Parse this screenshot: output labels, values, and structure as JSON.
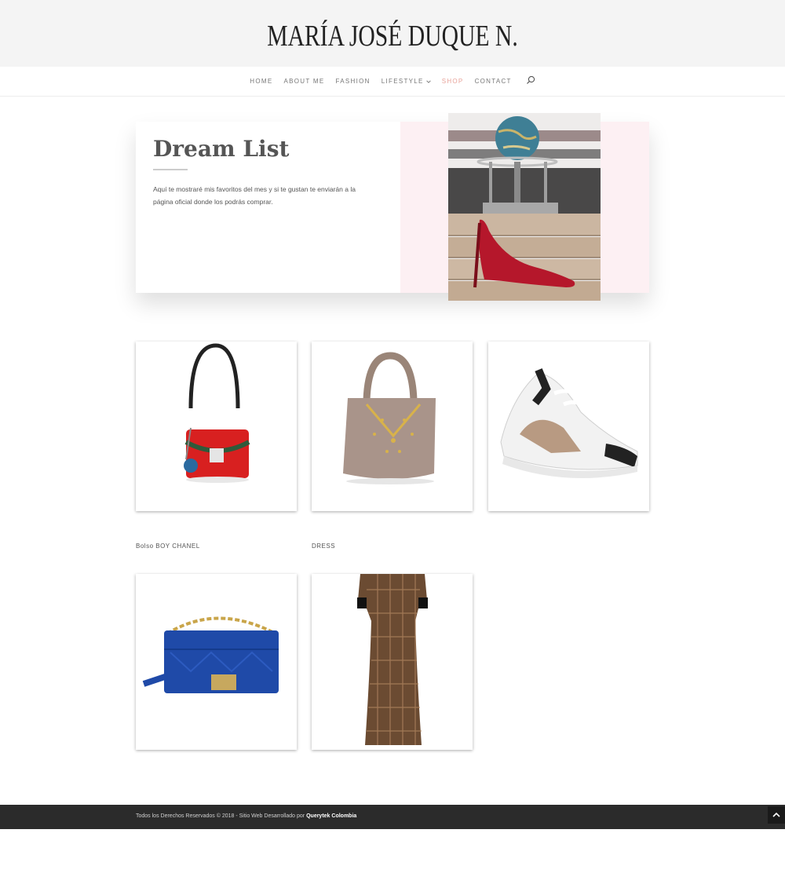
{
  "site": {
    "title": "MARÍA JOSÉ DUQUE N."
  },
  "nav": {
    "items": [
      {
        "label": "HOME"
      },
      {
        "label": "ABOUT ME"
      },
      {
        "label": "FASHION"
      },
      {
        "label": "LIFESTYLE"
      },
      {
        "label": "SHOP"
      },
      {
        "label": "CONTACT"
      }
    ],
    "active": "SHOP",
    "active_color": "#e8a39a"
  },
  "hero": {
    "title": "Dream List",
    "text": "Aquí te mostraré mis favoritos del mes y si te gustan te enviarán a la página oficial donde los podrás comprar.",
    "accent_color": "#fdf0f3"
  },
  "products": {
    "captions": [
      "Bolso BOY CHANEL",
      "DRESS"
    ]
  },
  "footer": {
    "text": "Todos los Derechos Reservados © 2018 - Sitio Web Desarrollado por",
    "link": "Querytek Colombia"
  },
  "icons": {
    "search": "search-icon",
    "dropdown": "chevron-down-icon",
    "back_to_top": "chevron-up-icon"
  }
}
